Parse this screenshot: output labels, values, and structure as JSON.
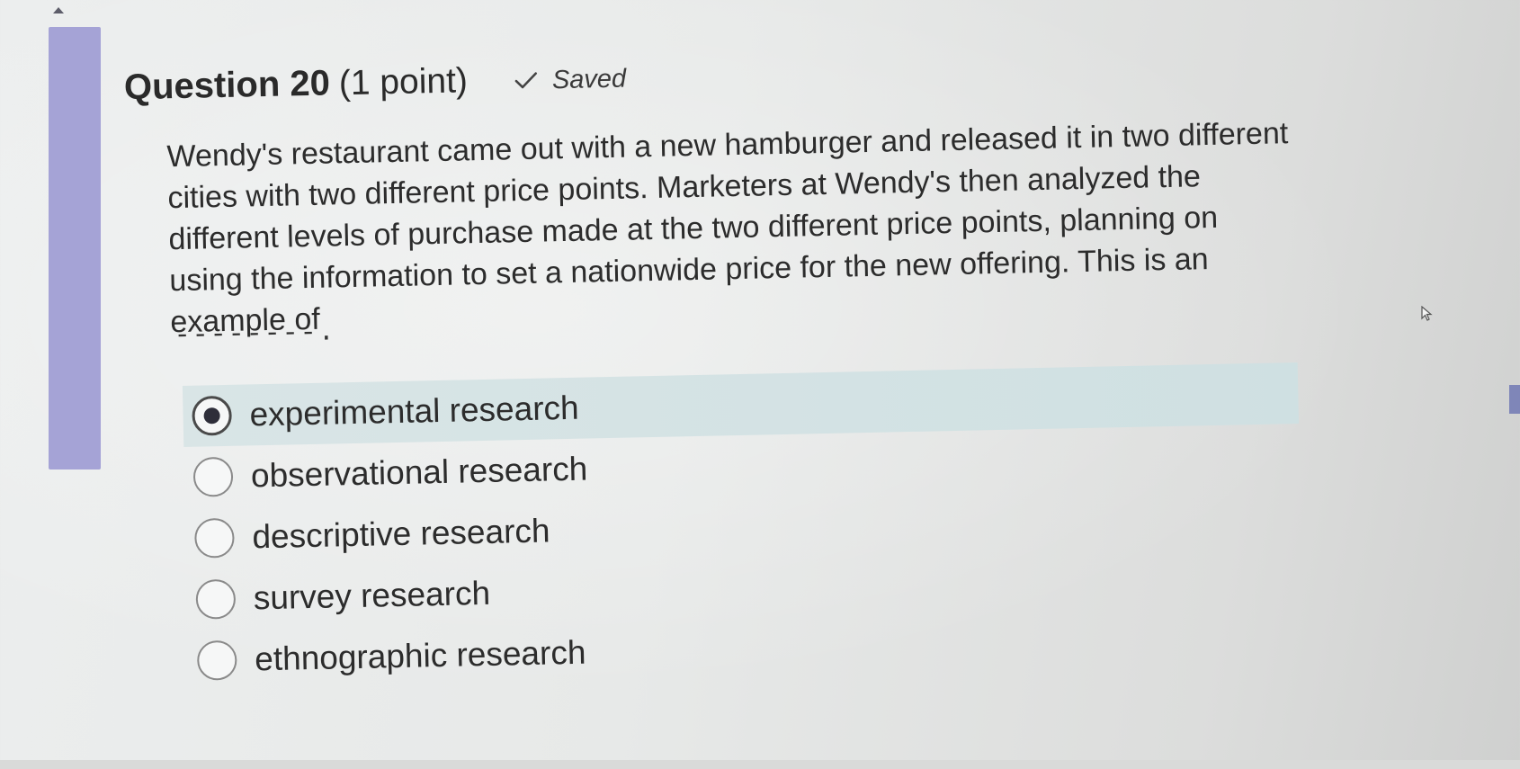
{
  "question": {
    "title": "Question 20",
    "points": "(1 point)",
    "status": "Saved",
    "text": "Wendy's restaurant came out with a new hamburger and released it in two different cities with two different price points. Marketers at Wendy's then analyzed the different levels of purchase made at the two different price points, planning on using the information to set a nationwide price for the new offering. This is an example of",
    "blank": "--------."
  },
  "options": [
    {
      "label": "experimental research",
      "selected": true
    },
    {
      "label": "observational research",
      "selected": false
    },
    {
      "label": "descriptive research",
      "selected": false
    },
    {
      "label": "survey research",
      "selected": false
    },
    {
      "label": "ethnographic research",
      "selected": false
    }
  ],
  "icons": {
    "status": "check-icon",
    "scroll": "scroll-up-icon",
    "pointer": "cursor-icon"
  },
  "colors": {
    "accent_bar": "#a5a3d6",
    "selected_row": "#d3e2e4",
    "radio_fill": "#2e2e3a"
  }
}
